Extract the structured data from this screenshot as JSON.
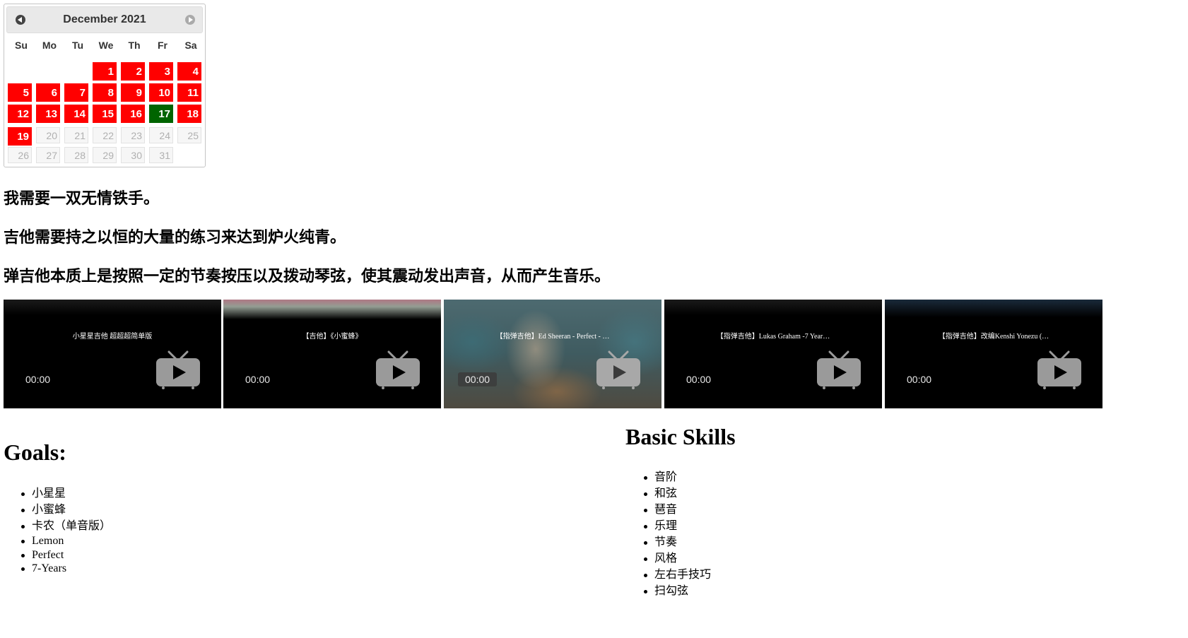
{
  "calendar": {
    "title": "December 2021",
    "weekdays": [
      "Su",
      "Mo",
      "Tu",
      "We",
      "Th",
      "Fr",
      "Sa"
    ],
    "highlight_color": "#ff0000",
    "today_color": "#006400",
    "days": [
      {
        "d": "1",
        "state": "marked"
      },
      {
        "d": "2",
        "state": "marked"
      },
      {
        "d": "3",
        "state": "marked"
      },
      {
        "d": "4",
        "state": "marked"
      },
      {
        "d": "5",
        "state": "marked"
      },
      {
        "d": "6",
        "state": "marked"
      },
      {
        "d": "7",
        "state": "marked"
      },
      {
        "d": "8",
        "state": "marked"
      },
      {
        "d": "9",
        "state": "marked"
      },
      {
        "d": "10",
        "state": "marked"
      },
      {
        "d": "11",
        "state": "marked"
      },
      {
        "d": "12",
        "state": "marked"
      },
      {
        "d": "13",
        "state": "marked"
      },
      {
        "d": "14",
        "state": "marked"
      },
      {
        "d": "15",
        "state": "marked"
      },
      {
        "d": "16",
        "state": "marked"
      },
      {
        "d": "17",
        "state": "today"
      },
      {
        "d": "18",
        "state": "marked"
      },
      {
        "d": "19",
        "state": "marked"
      },
      {
        "d": "20",
        "state": "future"
      },
      {
        "d": "21",
        "state": "future"
      },
      {
        "d": "22",
        "state": "future"
      },
      {
        "d": "23",
        "state": "future"
      },
      {
        "d": "24",
        "state": "future"
      },
      {
        "d": "25",
        "state": "future"
      },
      {
        "d": "26",
        "state": "future"
      },
      {
        "d": "27",
        "state": "future"
      },
      {
        "d": "28",
        "state": "future"
      },
      {
        "d": "29",
        "state": "future"
      },
      {
        "d": "30",
        "state": "future"
      },
      {
        "d": "31",
        "state": "future"
      }
    ]
  },
  "lines": [
    "我需要一双无情铁手。",
    "吉他需要持之以恒的大量的练习来达到炉火纯青。",
    "弹吉他本质上是按照一定的节奏按压以及拨动琴弦，使其震动发出声音，从而产生音乐。"
  ],
  "videos": [
    {
      "title": "小星星吉他 超超超简单版",
      "time": "00:00",
      "icon": "tv-play-icon"
    },
    {
      "title": "【吉他】《小蜜蜂》",
      "time": "00:00",
      "icon": "tv-play-icon"
    },
    {
      "title": "【指弹吉他】Ed Sheeran - Perfect - …",
      "time": "00:00",
      "icon": "tv-play-icon"
    },
    {
      "title": "【指弹吉他】Lukas Graham -7 Year…",
      "time": "00:00",
      "icon": "tv-play-icon"
    },
    {
      "title": "【指弹吉他】改编Kenshi Yonezu (…",
      "time": "00:00",
      "icon": "tv-play-icon"
    }
  ],
  "goals": {
    "heading": "Goals:",
    "items": [
      "小星星",
      "小蜜蜂",
      "卡农（单音版）",
      "Lemon",
      "Perfect",
      "7-Years"
    ]
  },
  "skills": {
    "heading": "Basic Skills",
    "items": [
      "音阶",
      "和弦",
      "琶音",
      "乐理",
      "节奏",
      "风格",
      "左右手技巧",
      "扫勾弦"
    ]
  }
}
